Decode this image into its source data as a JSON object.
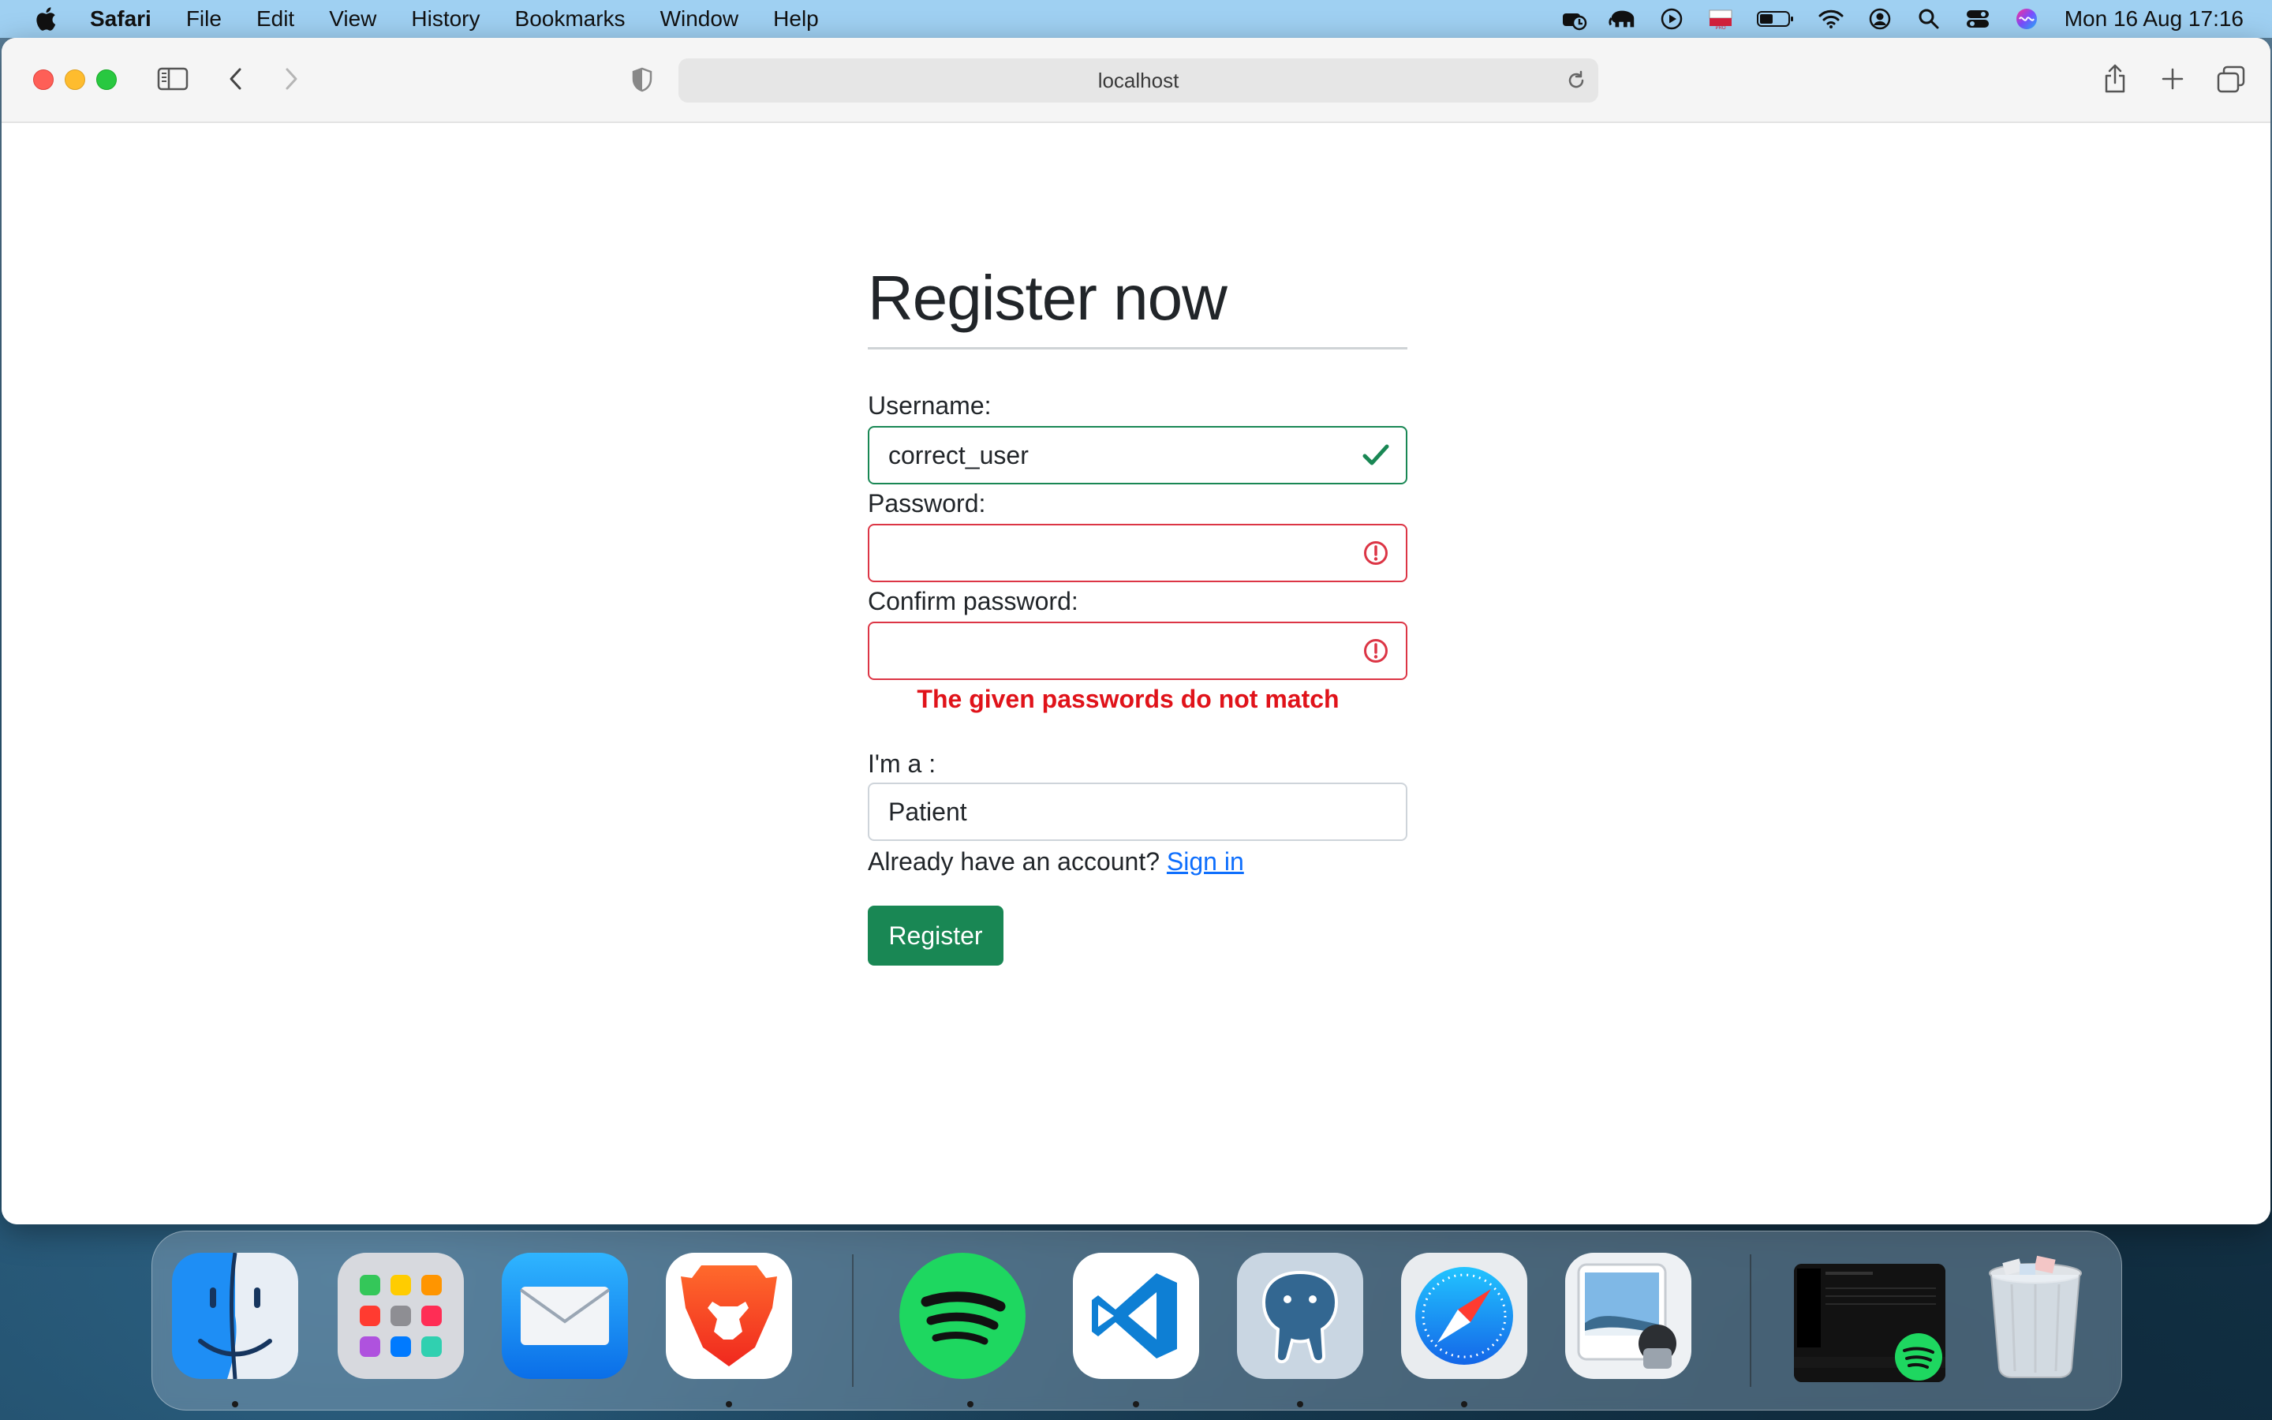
{
  "menubar": {
    "app_name": "Safari",
    "items": [
      "File",
      "Edit",
      "View",
      "History",
      "Bookmarks",
      "Window",
      "Help"
    ],
    "clock": "Mon 16 Aug  17:16"
  },
  "browser": {
    "url": "localhost"
  },
  "form": {
    "title": "Register now",
    "username_label": "Username:",
    "username_value": "correct_user",
    "password_label": "Password:",
    "password_value": "",
    "confirm_label": "Confirm password:",
    "confirm_value": "",
    "error_message": "The given passwords do not match",
    "role_label": "I'm a :",
    "role_value": "Patient",
    "account_prompt": "Already have an account?",
    "signin_link": "Sign in",
    "register_button": "Register"
  },
  "dock": {
    "apps": [
      "Finder",
      "Launchpad",
      "Mail",
      "Brave",
      "Spotify",
      "Visual Studio Code",
      "pgAdmin",
      "Safari",
      "Preview",
      "Spotify window",
      "Trash"
    ]
  },
  "colors": {
    "valid": "#198754",
    "invalid": "#dc3545",
    "error_text": "#e0131a",
    "link": "#0d6efd",
    "menubar": "#9fd0f2"
  }
}
